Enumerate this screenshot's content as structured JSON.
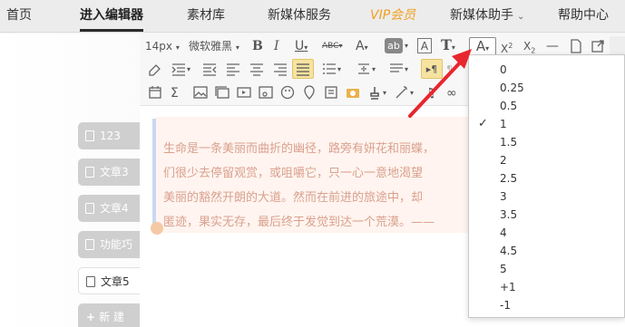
{
  "nav": {
    "items": [
      "首页",
      "进入编辑器",
      "素材库",
      "新媒体服务",
      "VIP会员",
      "新媒体助手",
      "帮助中心"
    ],
    "active_index": 1
  },
  "toolbar": {
    "font_size": "14px",
    "font_family": "微软雅黑"
  },
  "sidebar": {
    "tabs": [
      "123",
      "文章3",
      "文章4",
      "功能巧",
      "文章5"
    ],
    "current_index": 4,
    "new_label": "新 建"
  },
  "content": {
    "lines": [
      "生命是一条美丽而曲折的幽径，路旁有妍花和丽蝶，",
      "们很少去停留观赏，或咀嚼它，只一心一意地渴望",
      "美丽的豁然开朗的大道。然而在前进的旅途中，却",
      "匿迹，果实无存，最后终于发觉到达一个荒漠。——"
    ]
  },
  "line_height_menu": {
    "options": [
      "0",
      "0.25",
      "0.5",
      "1",
      "1.5",
      "2",
      "2.5",
      "3",
      "3.5",
      "4",
      "4.5",
      "5",
      "+1",
      "-1"
    ],
    "selected": "1"
  },
  "colors": {
    "vip": "#f0a020",
    "arrow": "#e8262e",
    "text_highlight": "#f6e3a0"
  }
}
